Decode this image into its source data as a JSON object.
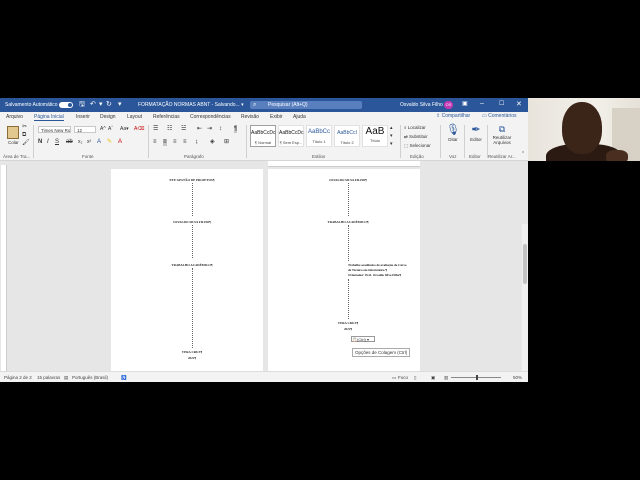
{
  "titlebar": {
    "autosave_label": "Salvamento Automático",
    "doc_title": "FORMATAÇÃO NORMAS ABNT - Salvando... ▾",
    "search_placeholder": "Pesquisar (Alt+Q)",
    "user_name": "Osvaldo Silva Filho",
    "user_initials": "OS"
  },
  "tabs": [
    "Arquivo",
    "Página Inicial",
    "Inserir",
    "Design",
    "Layout",
    "Referências",
    "Correspondências",
    "Revisão",
    "Exibir",
    "Ajuda"
  ],
  "share_label": "Compartilhar",
  "comments_label": "Comentários",
  "ribbon": {
    "paste_label": "Colar",
    "clipboard_group": "Área de Tra...",
    "font_name": "Times New Ro",
    "font_size": "12",
    "font_group": "Fonte",
    "paragraph_group": "Parágrafo",
    "styles_group": "Estilos",
    "styles": [
      {
        "preview": "AaBbCcDc",
        "name": "¶ Normal"
      },
      {
        "preview": "AaBbCcDc",
        "name": "¶ Sem Esp..."
      },
      {
        "preview": "AaBbCc",
        "name": "Título 1"
      },
      {
        "preview": "AaBbCcI",
        "name": "Título 2"
      },
      {
        "preview": "AaB",
        "name": "Título"
      }
    ],
    "find_label": "Localizar",
    "replace_label": "Substituir",
    "select_label": "Selecionar",
    "editing_group": "Edição",
    "dictate_label": "Ditar",
    "voice_group": "Voz",
    "editor_label": "Editor",
    "editor_group": "Editor",
    "reuse_label": "Reutilizar Arquivos",
    "reuse_group": "Reutilizar Ar..."
  },
  "pages": {
    "left": {
      "institution": "ETE GESTÃO DE PROJETOS¶",
      "author": "OSVALDO SILVA FILHO¶",
      "work": "TRABALHO ACADÊMICO¶",
      "city": "VERA CRUZ¶",
      "year": "2022¶"
    },
    "right": {
      "author": "OSVALDO SILVA FILHO¶",
      "work": "TRABALHO ACADÊMICO¶",
      "nature_1": "Trabalho acadêmico de avaliação do Curso",
      "nature_2": "de Técnico em Informática ¶",
      "nature_3": "Orientador: Prof. Osvaldo Silva Filho¶",
      "city": "VERA CRUZ¶",
      "year": "2022¶"
    }
  },
  "paste_options_button": "(Ctrl) ▾",
  "paste_tooltip": "Opções de Colagem (Ctrl)",
  "statusbar": {
    "page": "Página 2 de 2",
    "words": "15 palavras",
    "language": "Português (Brasil)",
    "focus": "Foco",
    "zoom": "50%"
  }
}
